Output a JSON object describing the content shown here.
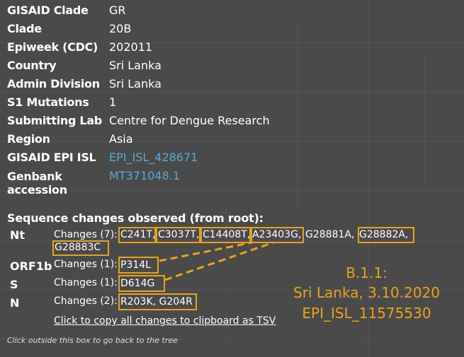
{
  "info": [
    {
      "key": "GISAID Clade",
      "value": "GR"
    },
    {
      "key": "Clade",
      "value": "20B"
    },
    {
      "key": "Epiweek (CDC)",
      "value": "202011"
    },
    {
      "key": "Country",
      "value": "Sri Lanka"
    },
    {
      "key": "Admin Division",
      "value": "Sri Lanka"
    },
    {
      "key": "S1 Mutations",
      "value": "1"
    },
    {
      "key": "Submitting Lab",
      "value": "Centre for Dengue Research"
    },
    {
      "key": "Region",
      "value": "Asia"
    },
    {
      "key": "GISAID EPI ISL",
      "value": "EPI_ISL_428671"
    },
    {
      "key": "Genbank accession",
      "value": "MT371048.1"
    }
  ],
  "sequence": {
    "title": "Sequence changes observed (from root):",
    "genes": [
      {
        "name": "Nt",
        "changes_label": "Changes (7):",
        "mutations": [
          "C241T,",
          "C3037T,",
          "C14408T,",
          "A23403G,",
          "G28881A,",
          "G28882A,",
          "G28883C"
        ]
      },
      {
        "name": "ORF1b",
        "changes_label": "Changes (1):",
        "mutations": [
          "P314L"
        ]
      },
      {
        "name": "S",
        "changes_label": "Changes (1):",
        "mutations": [
          "D614G"
        ]
      },
      {
        "name": "N",
        "changes_label": "Changes (2):",
        "mutations": [
          "R203K, G204R"
        ]
      }
    ],
    "copy_link": "Click to copy all changes to clipboard as TSV",
    "footer": "Click outside this box to go back to the tree"
  },
  "annotation": {
    "line1": "B.1.1:",
    "line2": "Sri Lanka, 3.10.2020",
    "line3": "EPI_ISL_11575530",
    "color": "#e8a317"
  },
  "colors": {
    "background": "#4a4a4a",
    "link": "#5aa8d6",
    "highlight": "#e8a317"
  }
}
